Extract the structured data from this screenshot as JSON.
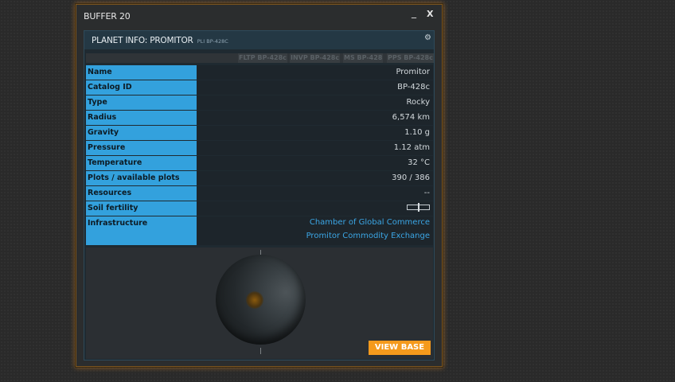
{
  "window": {
    "title": "BUFFER 20",
    "minimize_label": "_",
    "close_label": "X"
  },
  "panel": {
    "title": "PLANET INFO: PROMITOR",
    "subtitle": "PLI BP-428C",
    "tabs": [
      "FLTP BP-428c",
      "INVP BP-428c",
      "MS BP-428",
      "PPS BP-428c"
    ]
  },
  "rows": [
    {
      "label": "Name",
      "value": "Promitor"
    },
    {
      "label": "Catalog ID",
      "value": "BP-428c"
    },
    {
      "label": "Type",
      "value": "Rocky"
    },
    {
      "label": "Radius",
      "value": "6,574 km"
    },
    {
      "label": "Gravity",
      "value": "1.10 g"
    },
    {
      "label": "Pressure",
      "value": "1.12 atm"
    },
    {
      "label": "Temperature",
      "value": "32 °C"
    },
    {
      "label": "Plots / available plots",
      "value": "390 / 386"
    },
    {
      "label": "Resources",
      "value": "--"
    },
    {
      "label": "Soil fertility",
      "value": ""
    }
  ],
  "infrastructure": {
    "label": "Infrastructure",
    "links": [
      "Chamber of Global Commerce",
      "Promitor Commodity Exchange"
    ]
  },
  "view_base_label": "VIEW BASE",
  "colors": {
    "accent_orange": "#f59a1c",
    "label_blue": "#33a1dd",
    "link_blue": "#3ba6e5"
  }
}
